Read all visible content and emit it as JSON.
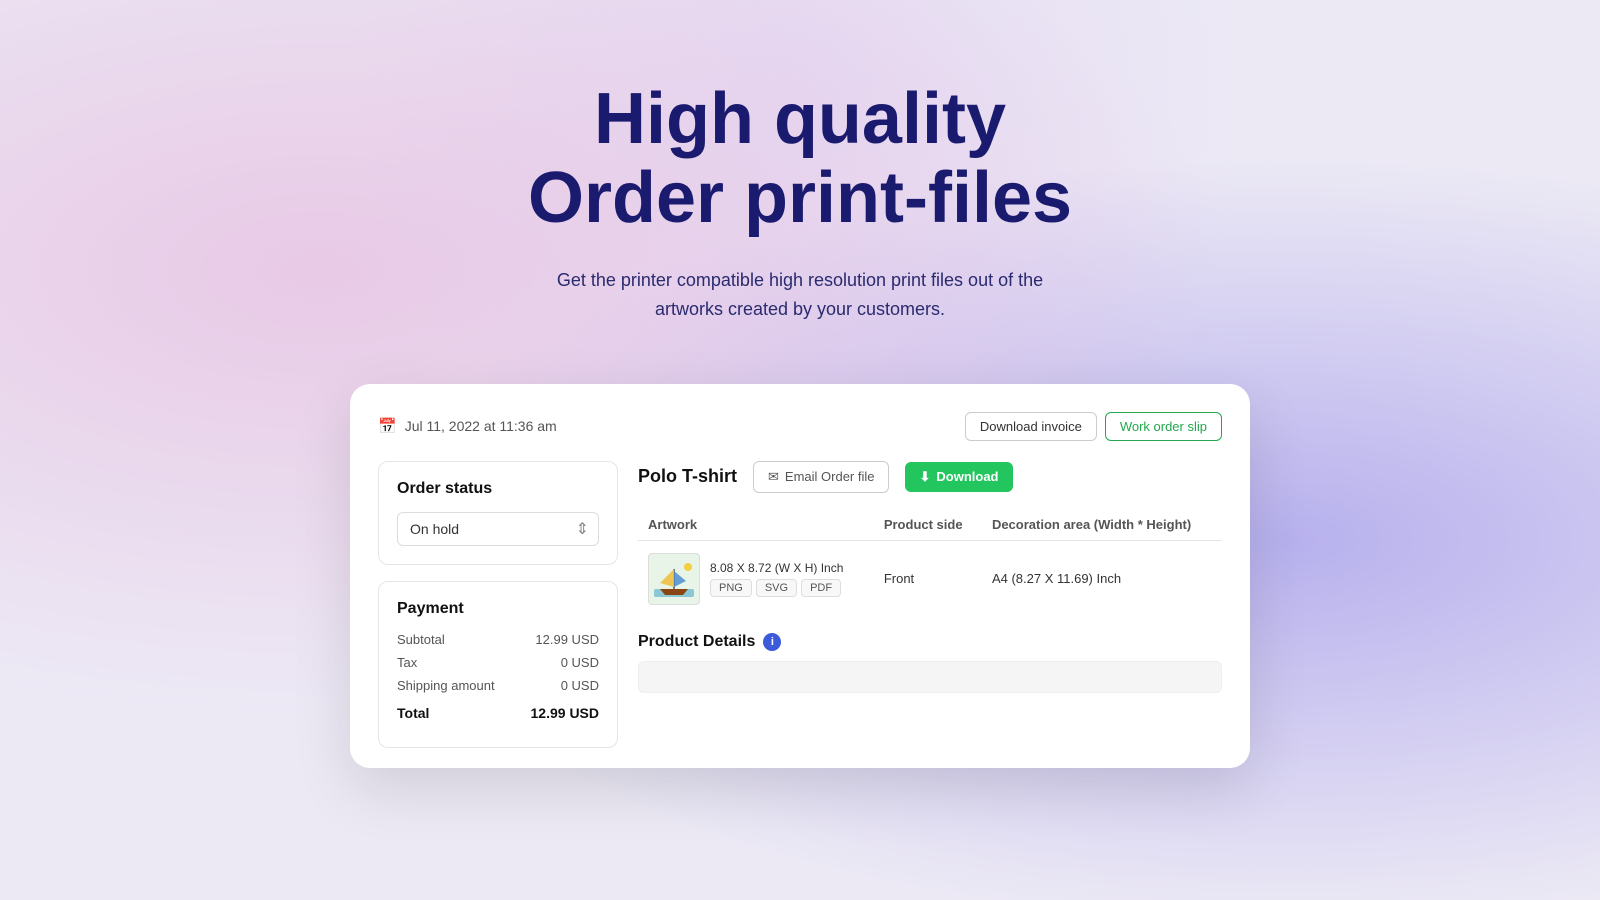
{
  "hero": {
    "line1": "High quality",
    "line2": "Order print-files",
    "subtitle_line1": "Get the printer compatible high resolution print files out of the",
    "subtitle_line2": "artworks created by your customers."
  },
  "card": {
    "date": "Jul 11, 2022 at 11:36 am",
    "actions": {
      "download_invoice": "Download invoice",
      "work_order_slip": "Work order slip"
    },
    "order_status": {
      "title": "Order status",
      "value": "On hold"
    },
    "payment": {
      "title": "Payment",
      "subtotal_label": "Subtotal",
      "subtotal_value": "12.99 USD",
      "tax_label": "Tax",
      "tax_value": "0 USD",
      "shipping_label": "Shipping amount",
      "shipping_value": "0 USD",
      "total_label": "Total",
      "total_value": "12.99 USD"
    },
    "product": {
      "name": "Polo T-shirt",
      "email_btn": "Email Order file",
      "download_btn": "Download",
      "table": {
        "col1": "Artwork",
        "col2": "Product side",
        "col3": "Decoration area (Width * Height)",
        "row": {
          "dimensions": "8.08 X 8.72 (W X H) Inch",
          "badges": [
            "PNG",
            "SVG",
            "PDF"
          ],
          "side": "Front",
          "area": "A4 (8.27 X 11.69) Inch"
        }
      },
      "details_title": "Product Details"
    }
  }
}
